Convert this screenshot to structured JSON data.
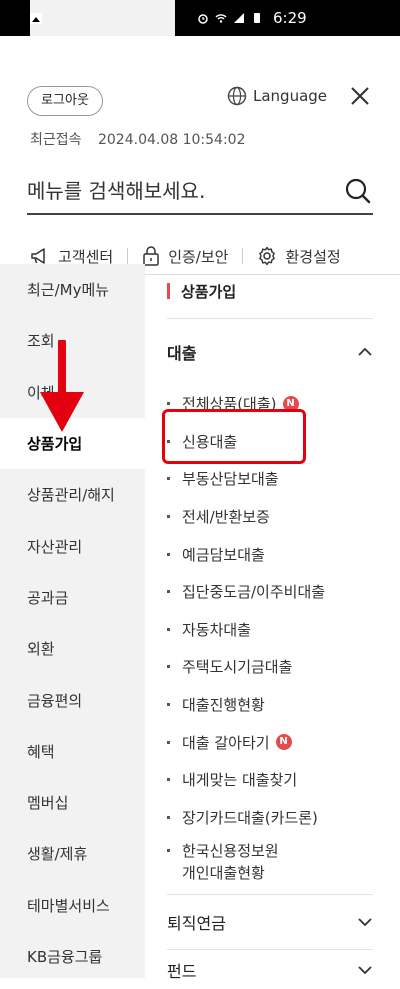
{
  "statusbar": {
    "time": "6:29"
  },
  "header": {
    "logout_label": "로그아웃",
    "language_label": "Language",
    "last_login_label": "최근접속",
    "last_login_value": "2024.04.08 10:54:02",
    "search_placeholder": "메뉴를 검색해보세요."
  },
  "quick_links": [
    {
      "label": "고객센터",
      "icon": "megaphone-icon"
    },
    {
      "label": "인증/보안",
      "icon": "lock-icon"
    },
    {
      "label": "환경설정",
      "icon": "gear-icon"
    }
  ],
  "sidebar": {
    "items": [
      {
        "label": "최근/My메뉴"
      },
      {
        "label": "조회"
      },
      {
        "label": "이체"
      },
      {
        "label": "상품가입"
      },
      {
        "label": "상품관리/해지"
      },
      {
        "label": "자산관리"
      },
      {
        "label": "공과금"
      },
      {
        "label": "외환"
      },
      {
        "label": "금융편의"
      },
      {
        "label": "혜택"
      },
      {
        "label": "멤버십"
      },
      {
        "label": "생활/제휴"
      },
      {
        "label": "테마별서비스"
      },
      {
        "label": "KB금융그룹"
      }
    ],
    "active_index": 3
  },
  "content": {
    "section_title": "상품가입",
    "group_title": "대출",
    "sub_items": [
      {
        "label": "전체상품(대출)",
        "badge": "N"
      },
      {
        "label": "신용대출"
      },
      {
        "label": "부동산담보대출"
      },
      {
        "label": "전세/반환보증"
      },
      {
        "label": "예금담보대출"
      },
      {
        "label": "집단중도금/이주비대출"
      },
      {
        "label": "자동차대출"
      },
      {
        "label": "주택도시기금대출"
      },
      {
        "label": "대출진행현황"
      },
      {
        "label": "대출 갈아타기",
        "badge": "N"
      },
      {
        "label": "내게맞는 대출찾기"
      },
      {
        "label": "장기카드대출(카드론)"
      },
      {
        "label": "한국신용정보원",
        "label2": "개인대출현황"
      }
    ],
    "collapsed_groups": [
      {
        "label": "퇴직연금"
      },
      {
        "label": "펀드"
      }
    ]
  },
  "colors": {
    "accent": "#e64a4a",
    "highlight": "#e3000f"
  }
}
